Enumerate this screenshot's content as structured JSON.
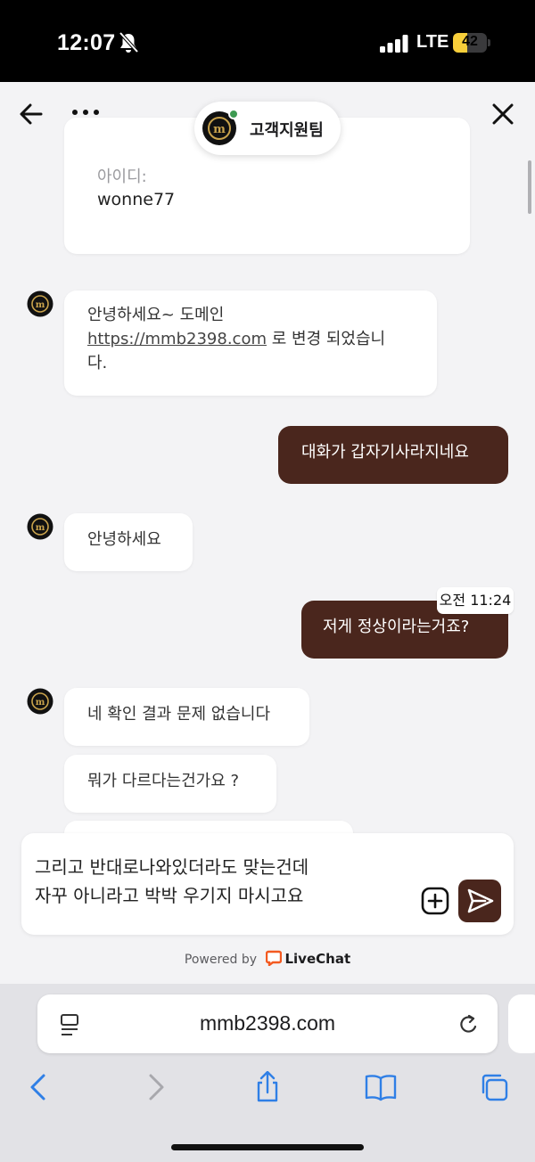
{
  "status_bar": {
    "time": "12:07",
    "network": "LTE",
    "battery_level": "42",
    "battery_fraction": 0.42
  },
  "header": {
    "agent_name": "고객지원팀",
    "online": true
  },
  "messages": {
    "id_label": "아이디:",
    "id_value": "wonne77",
    "agent_domain_prefix": "안녕하세요~ 도메인",
    "agent_domain_link": "https://mmb2398.com",
    "agent_domain_suffix": "로 변경 되었습니",
    "agent_domain_end": "다.",
    "visitor_1": "대화가 갑자기사라지네요",
    "agent_2": "안녕하세요",
    "timestamp": "오전 11:24",
    "visitor_2": "저게 정상이라는거죠?",
    "agent_3": "네 확인 결과 문제 없습니다",
    "agent_4": "뭐가 다르다는건가요 ?"
  },
  "composer": {
    "line_1": "그리고 반대로나와있더라도 맞는건데",
    "line_2": "자꾸 아니라고 박박 우기지 마시고요"
  },
  "footer": {
    "powered_by": "Powered by",
    "brand": "LiveChat"
  },
  "browser": {
    "url": "mmb2398.com"
  },
  "colors": {
    "visitor_bubble": "#4a261d",
    "online": "#3e9a52",
    "accent_blue": "#2f7fe6",
    "battery": "#f8cf3a"
  }
}
